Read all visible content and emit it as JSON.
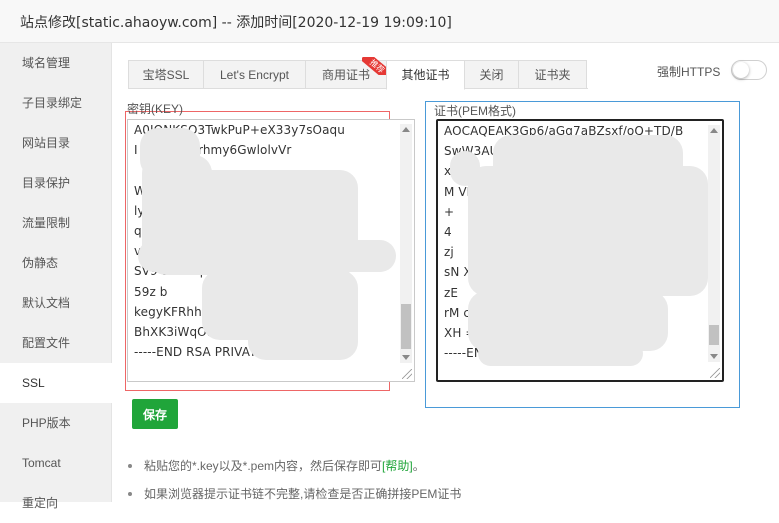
{
  "title": "站点修改[static.ahaoyw.com] -- 添加时间[2020-12-19 19:09:10]",
  "sidebar": {
    "items": [
      "域名管理",
      "子目录绑定",
      "网站目录",
      "目录保护",
      "流量限制",
      "伪静态",
      "默认文档",
      "配置文件",
      "SSL",
      "PHP版本",
      "Tomcat",
      "重定向"
    ],
    "active": "SSL"
  },
  "tabs": {
    "items": [
      "宝塔SSL",
      "Let's Encrypt",
      "商用证书",
      "其他证书",
      "关闭",
      "证书夹"
    ],
    "badge": "推荐",
    "active": "其他证书"
  },
  "force_https": {
    "label": "强制HTTPS",
    "enabled": false
  },
  "key": {
    "label": "密钥(KEY)",
    "lines": [
      "A0IONKSO3TwkPuP+eX33y7sOaqu",
      "I                    Vm4QuI4rhmy6GwlolvVr",
      "",
      "                                    Wv0Rj5",
      "                                      ly",
      "                                    q5ek",
      "v",
      "SV9     SD                         D8pY",
      "59z                                    b",
      "kegyKFRhh                  MdOsFwSncalIQ",
      "BhXK3iWqO9los                   QL=",
      "-----END RSA PRIVATE KEY-----"
    ]
  },
  "cert": {
    "label": "证书(PEM格式)",
    "lines": [
      "AOCAQEAK3Gp6/aGq7aBZsxf/oQ+TD/B",
      "SwW3AU4ETK+GQf2k                Pomun",
      "x2",
      "M                                    VB",
      "+",
      "4",
      "zj",
      "sN                                   Xb",
      "zE",
      "rM                                  czBZ",
      "XH                                 =",
      "-----END CERTIFICATE-----"
    ]
  },
  "save_label": "保存",
  "tips": {
    "items": [
      {
        "text": "粘贴您的*.key以及*.pem内容，然后保存即可",
        "link": "[帮助]",
        "suffix": "。"
      },
      {
        "text": "如果浏览器提示证书链不完整,请检查是否正确拼接PEM证书",
        "link": "",
        "suffix": ""
      }
    ]
  },
  "colors": {
    "accent": "#20a53a",
    "key_border": "#e66666",
    "cert_border": "#4a9ad8",
    "badge": "#e53935"
  }
}
